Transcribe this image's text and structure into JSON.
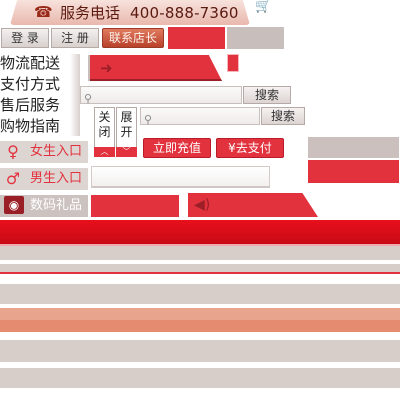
{
  "header": {
    "phone_label": "服务电话",
    "phone_number": "400-888-7360",
    "icons": [
      "phone-icon",
      "cart-icon"
    ]
  },
  "account": {
    "login_label": "登 录",
    "register_label": "注 册",
    "contact_label": "联系店长"
  },
  "menu": {
    "items": [
      {
        "label": "物流配送"
      },
      {
        "label": "支付方式"
      },
      {
        "label": "售后服务"
      },
      {
        "label": "购物指南"
      }
    ]
  },
  "search": {
    "button_label": "搜索",
    "button_label_2": "搜索",
    "placeholder": ""
  },
  "toggles": {
    "close_label": "关闭",
    "expand_label": "展开"
  },
  "actions": {
    "recharge_label": "立即充值",
    "pay_label": "¥去支付"
  },
  "categories": [
    {
      "label": "女生入口",
      "icon": "female-icon"
    },
    {
      "label": "男生入口",
      "icon": "male-icon"
    },
    {
      "label": "数码礼品",
      "icon": "camera-icon"
    }
  ],
  "colors": {
    "accent_red": "#e2323e",
    "soft_grey": "#ddd5d2",
    "salmon": "#e58b70"
  }
}
